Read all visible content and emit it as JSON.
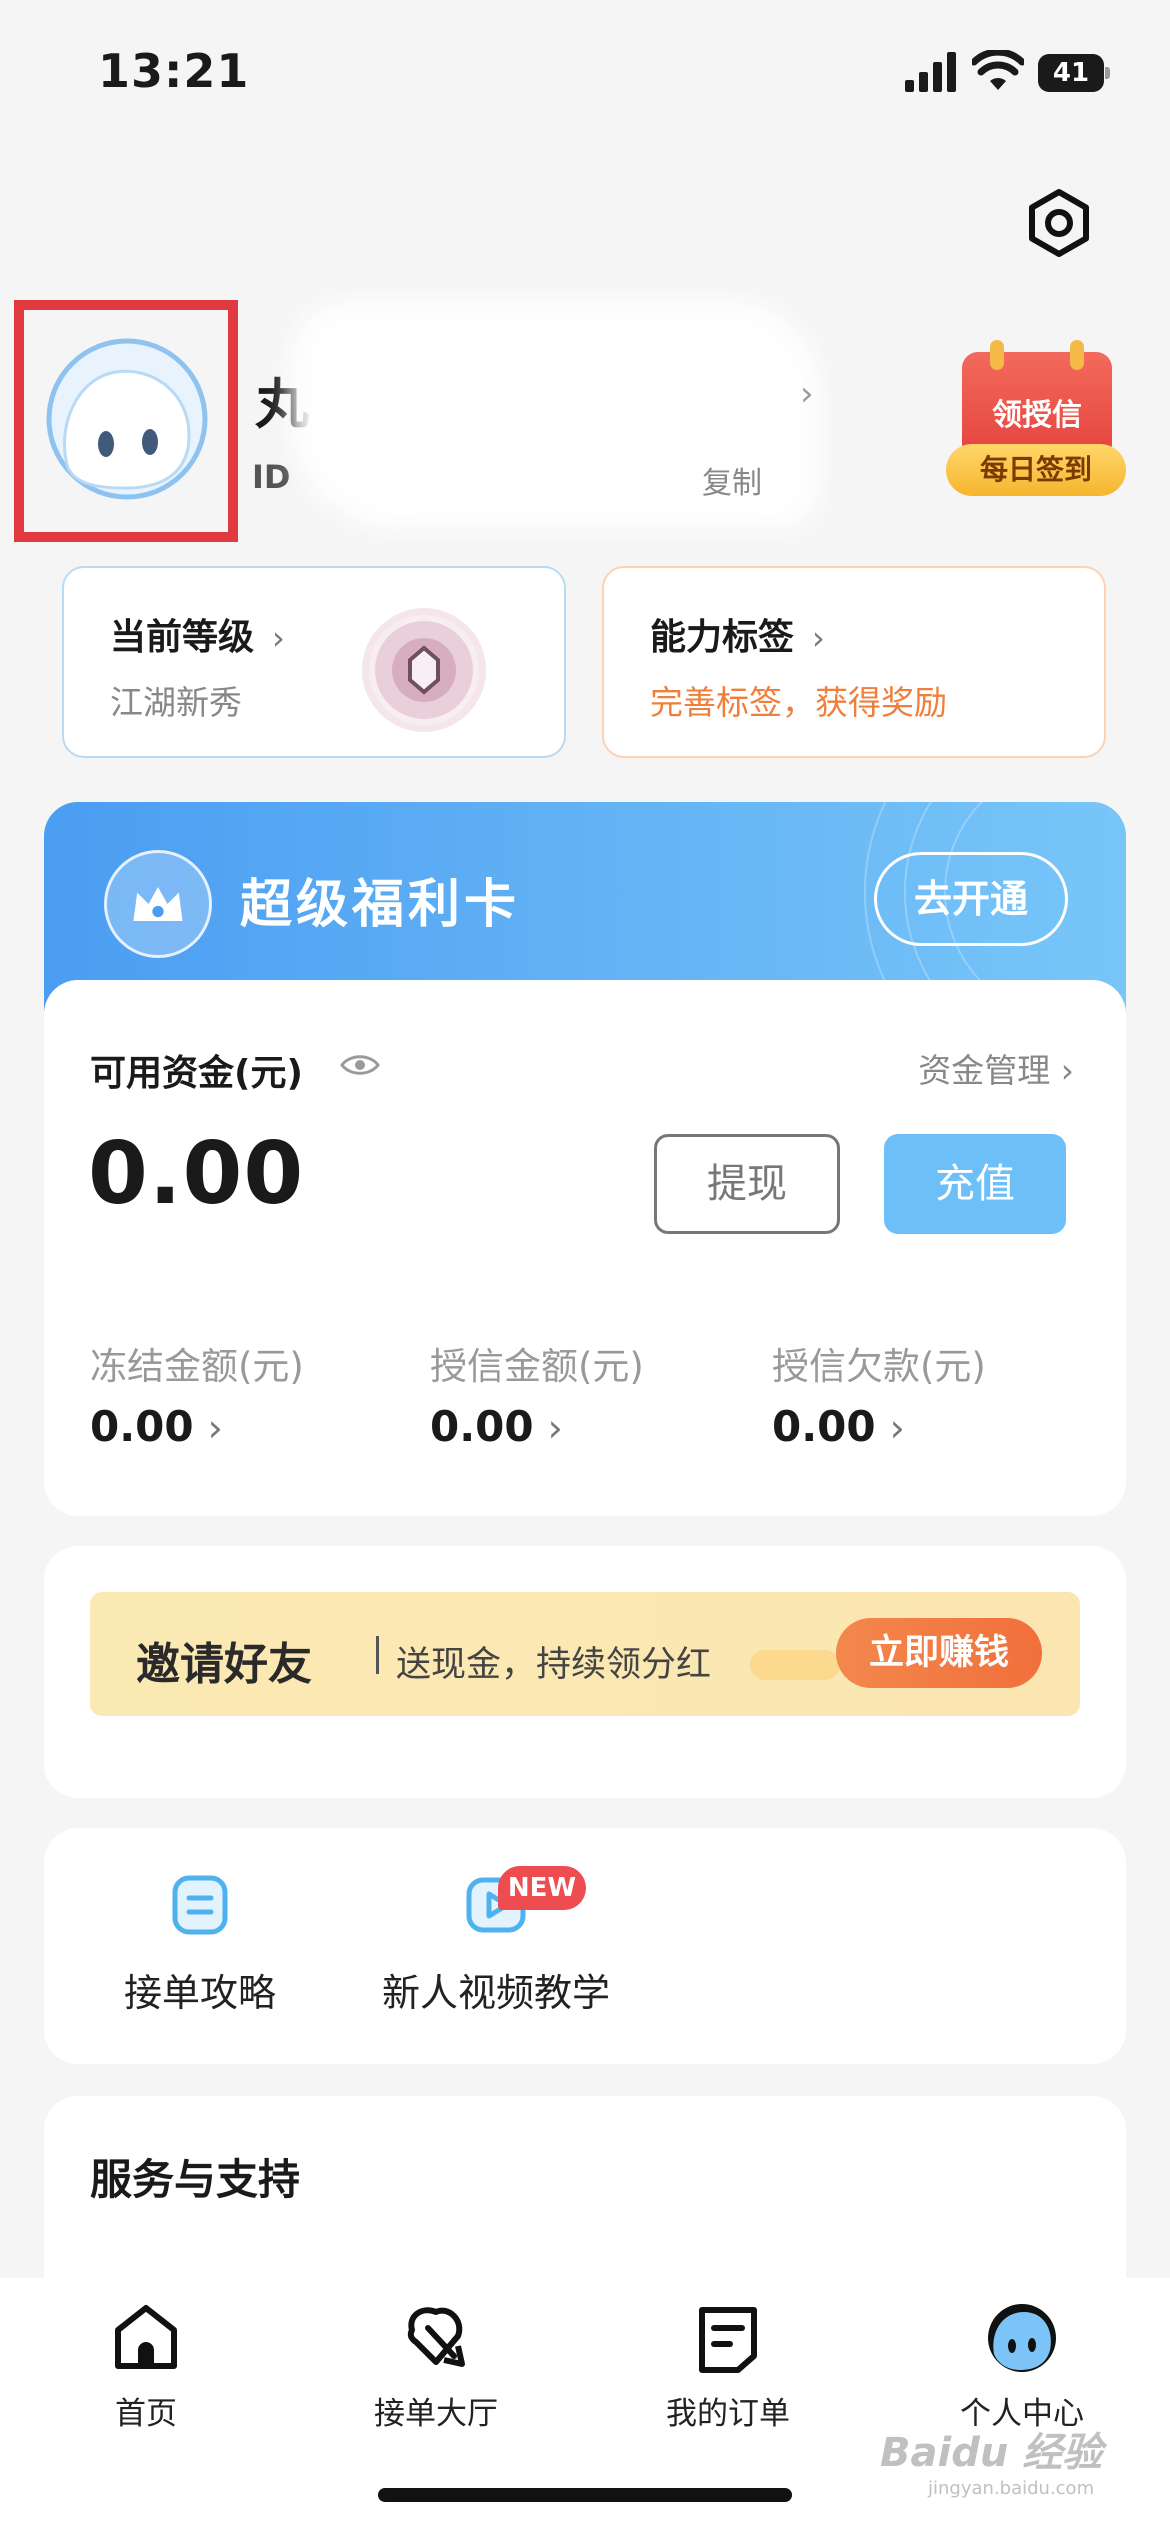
{
  "status_bar": {
    "time": "13:21",
    "battery": "41"
  },
  "profile": {
    "nickname_visible": "丸",
    "id_prefix": "ID",
    "copy_label": "复制",
    "signin_title": "领授信",
    "signin_badge": "每日签到"
  },
  "level_card": {
    "title": "当前等级",
    "subtitle": "江湖新秀"
  },
  "ability_card": {
    "title": "能力标签",
    "subtitle": "完善标签，获得奖励"
  },
  "welfare": {
    "title": "超级福利卡",
    "button": "去开通"
  },
  "funds": {
    "label": "可用资金(元)",
    "manage_label": "资金管理",
    "amount": "0.00",
    "withdraw_label": "提现",
    "recharge_label": "充值",
    "stats": [
      {
        "label": "冻结金额(元)",
        "value": "0.00"
      },
      {
        "label": "授信金额(元)",
        "value": "0.00"
      },
      {
        "label": "授信欠款(元)",
        "value": "0.00"
      }
    ]
  },
  "invite": {
    "title": "邀请好友",
    "subtitle": "送现金，持续领分红",
    "button": "立即赚钱"
  },
  "tools": [
    {
      "label": "接单攻略",
      "icon": "doc-icon"
    },
    {
      "label": "新人视频教学",
      "icon": "video-play-icon",
      "badge": "NEW"
    }
  ],
  "service": {
    "title": "服务与支持"
  },
  "bottom_nav": [
    {
      "label": "首页",
      "icon": "home-icon"
    },
    {
      "label": "接单大厅",
      "icon": "hall-icon"
    },
    {
      "label": "我的订单",
      "icon": "orders-icon"
    },
    {
      "label": "个人中心",
      "icon": "profile-icon"
    }
  ],
  "watermark": {
    "text": "Baidu 经验",
    "sub": "jingyan.baidu.com"
  },
  "colors": {
    "accent_blue": "#6cc0f7",
    "welfare_gradient_start": "#4b9df2",
    "highlight_red": "#e0393f",
    "orange": "#f07f3c"
  }
}
